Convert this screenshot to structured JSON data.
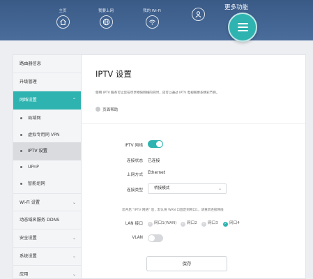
{
  "topnav": {
    "home": "主页",
    "internet": "我要上网",
    "wifi": "我的 Wi-Fi",
    "more": "更多功能"
  },
  "sidebar": {
    "items": [
      {
        "label": "路由器信息",
        "chevron": false
      },
      {
        "label": "升级管理",
        "chevron": false
      },
      {
        "label": "网络设置",
        "chevron": true,
        "active": true
      }
    ],
    "sub_items": [
      {
        "label": "局域网"
      },
      {
        "label": "虚拟专用网 VPN"
      },
      {
        "label": "IPTV 设置",
        "selected": true
      },
      {
        "label": "UPnP"
      },
      {
        "label": "智能组网"
      }
    ],
    "lower_items": [
      {
        "label": "Wi-Fi 设置",
        "chevron": true
      },
      {
        "label": "动态域名服务 DDNS",
        "chevron": false
      },
      {
        "label": "安全设置",
        "chevron": true
      },
      {
        "label": "系统设置",
        "chevron": true
      },
      {
        "label": "应用",
        "chevron": true
      }
    ]
  },
  "content": {
    "title": "IPTV 设置",
    "description": "使用 IPTV 服务可让您在尽享畅快网络的同时，还可以通过 IPTV 电视看更多精彩节目。",
    "help": "页面帮助",
    "iptv_label": "IPTV 网络",
    "iptv_enabled": true,
    "status_label": "连接状态",
    "status_value": "已连接",
    "wan_method_label": "上网方式",
    "wan_method_value": "Ethernet",
    "conn_type_label": "连接类型",
    "conn_type_value": "桥接模式",
    "lan_note": "您开启 \"IPTV 网络\" 后，默认将 WAN 口固定到网口1，请重新连接网线",
    "lan_label": "LAN 接口",
    "ports": [
      {
        "label": "网口1(WAN)",
        "checked": false
      },
      {
        "label": "网口2",
        "checked": false
      },
      {
        "label": "网口3",
        "checked": false
      },
      {
        "label": "网口4",
        "checked": true
      }
    ],
    "vlan_label": "VLAN",
    "vlan_enabled": false,
    "save": "保存"
  },
  "colors": {
    "accent": "#2fb3b0",
    "topbar": "#3f628f"
  }
}
